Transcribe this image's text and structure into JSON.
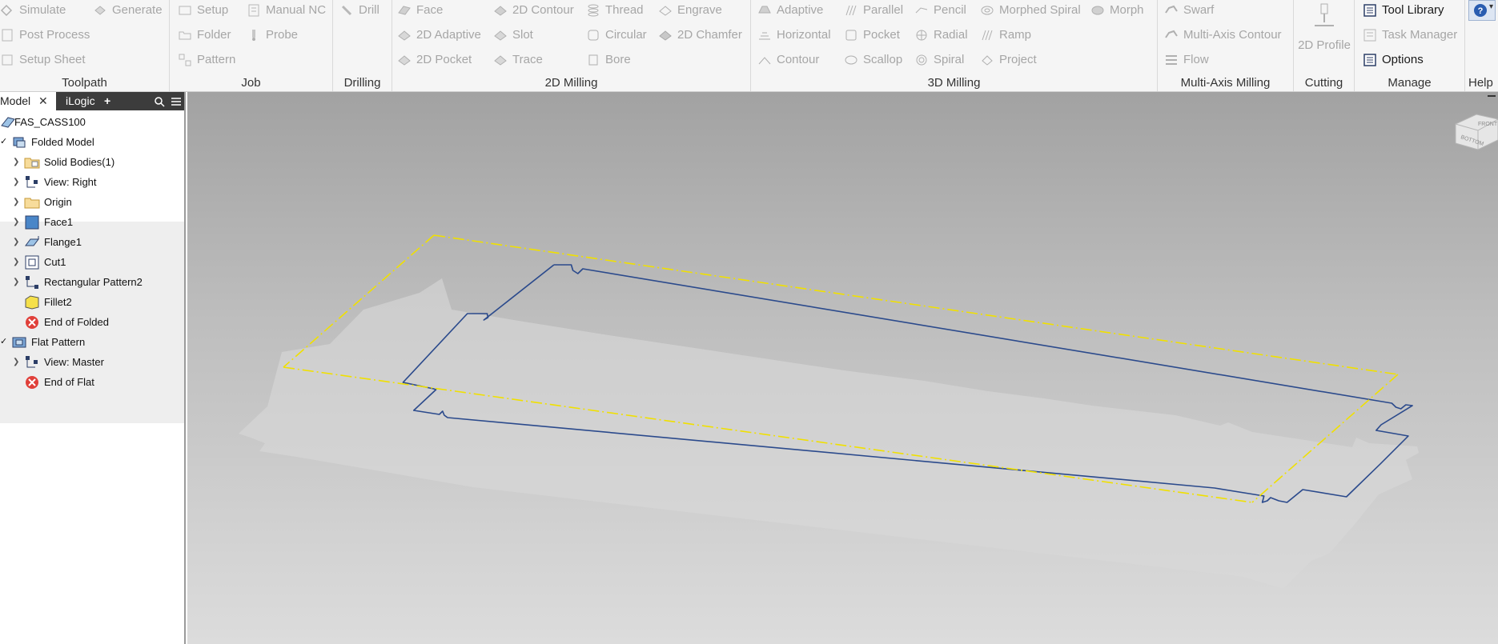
{
  "ribbon": {
    "panels": {
      "toolpath": "Toolpath",
      "job": "Job",
      "drilling": "Drilling",
      "milling2d": "2D Milling",
      "milling3d": "3D Milling",
      "multiaxis": "Multi-Axis Milling",
      "cutting": "Cutting",
      "manage": "Manage",
      "help": "Help"
    },
    "toolpath": {
      "simulate": "Simulate",
      "generate": "Generate",
      "post_process": "Post Process",
      "setup_sheet": "Setup Sheet"
    },
    "job": {
      "setup": "Setup",
      "manual_nc": "Manual NC",
      "folder": "Folder",
      "probe": "Probe",
      "pattern": "Pattern"
    },
    "drilling": {
      "drill": "Drill"
    },
    "milling2d": {
      "face": "Face",
      "contour2d": "2D Contour",
      "thread": "Thread",
      "engrave": "Engrave",
      "adaptive2d": "2D Adaptive",
      "slot": "Slot",
      "circular": "Circular",
      "chamfer2d": "2D Chamfer",
      "pocket2d": "2D Pocket",
      "trace": "Trace",
      "bore": "Bore"
    },
    "milling3d": {
      "adaptive": "Adaptive",
      "parallel": "Parallel",
      "pencil": "Pencil",
      "morphed_spiral": "Morphed Spiral",
      "morph": "Morph",
      "horizontal": "Horizontal",
      "pocket": "Pocket",
      "radial": "Radial",
      "ramp": "Ramp",
      "contour": "Contour",
      "scallop": "Scallop",
      "spiral": "Spiral",
      "project": "Project"
    },
    "multiaxis": {
      "swarf": "Swarf",
      "multi_axis_contour": "Multi-Axis Contour",
      "flow": "Flow"
    },
    "cutting": {
      "profile2d": "2D Profile"
    },
    "manage": {
      "tool_library": "Tool Library",
      "task_manager": "Task Manager",
      "options": "Options"
    }
  },
  "browser": {
    "tabs": {
      "model": "Model",
      "ilogic": "iLogic",
      "add": "+"
    },
    "root": "FAS_CASS100",
    "folded_model": "Folded Model",
    "folded_items": [
      "Solid Bodies(1)",
      "View: Right",
      "Origin",
      "Face1",
      "Flange1",
      "Cut1",
      "Rectangular Pattern2",
      "Fillet2",
      "End of Folded"
    ],
    "flat_pattern": "Flat Pattern",
    "flat_items": [
      "View: Master",
      "End of Flat"
    ]
  },
  "viewcube": {
    "front": "FRONT",
    "bottom": "BOTTOM"
  },
  "colors": {
    "ribbon_bg": "#f5f5f5",
    "sketch_edge": "#2b4a8c",
    "bend_line": "#f0e000",
    "tab_bar": "#3c3c3c"
  }
}
